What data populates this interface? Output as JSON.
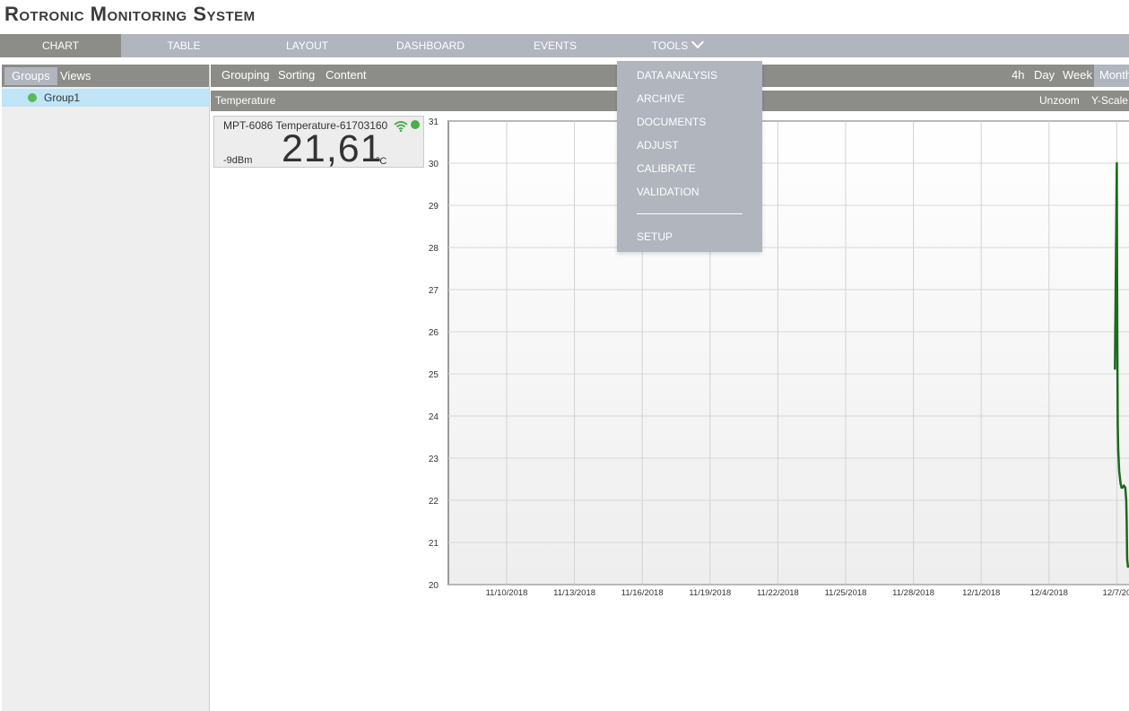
{
  "app": {
    "title": "Rotronic Monitoring System"
  },
  "nav": {
    "items": [
      {
        "label": "CHART"
      },
      {
        "label": "TABLE"
      },
      {
        "label": "LAYOUT"
      },
      {
        "label": "DASHBOARD"
      },
      {
        "label": "EVENTS"
      },
      {
        "label": "TOOLS"
      }
    ],
    "active": "CHART"
  },
  "left_panel": {
    "tabs": [
      {
        "label": "Groups"
      },
      {
        "label": "Views"
      }
    ],
    "groups": [
      {
        "name": "Group1",
        "status_color": "#5cb85c"
      }
    ]
  },
  "toolbar": {
    "grouping": "Grouping",
    "sorting": "Sorting",
    "content": "Content",
    "ranges": [
      {
        "label": "4h"
      },
      {
        "label": "Day"
      },
      {
        "label": "Week"
      },
      {
        "label": "Month"
      }
    ],
    "active_range": "Month"
  },
  "chart_header": {
    "title": "Temperature",
    "unzoom": "Unzoom",
    "yscale": "Y-Scale"
  },
  "sensor": {
    "name": "MPT-6086 Temperature-61703160",
    "signal": "-9dBm",
    "value": "21,61",
    "unit": "°C",
    "status_color": "#4cae4c"
  },
  "tools_menu": {
    "items": [
      {
        "label": "DATA ANALYSIS"
      },
      {
        "label": "ARCHIVE"
      },
      {
        "label": "DOCUMENTS"
      },
      {
        "label": "ADJUST"
      },
      {
        "label": "CALIBRATE"
      },
      {
        "label": "VALIDATION"
      },
      {
        "label": "SETUP"
      }
    ]
  },
  "chart_data": {
    "type": "line",
    "title": "Temperature",
    "xlabel": "",
    "ylabel": "",
    "ylim": [
      20,
      31
    ],
    "yticks": [
      20,
      21,
      22,
      23,
      24,
      25,
      26,
      27,
      28,
      29,
      30,
      31
    ],
    "xtick_labels": [
      "11/10/2018",
      "11/13/2018",
      "11/16/2018",
      "11/19/2018",
      "11/22/2018",
      "11/25/2018",
      "11/28/2018",
      "12/1/2018",
      "12/4/2018",
      "12/7/20"
    ],
    "grid": true,
    "series_color": "#1a6b1a",
    "series": [
      {
        "x": [
          "12/6/2018 22:00",
          "12/7/2018 00:00",
          "12/7/2018 00:30",
          "12/7/2018 01:00",
          "12/7/2018 01:30",
          "12/7/2018 02:30",
          "12/7/2018 04:00",
          "12/7/2018 05:00",
          "12/7/2018 06:00",
          "12/7/2018 07:30",
          "12/7/2018 09:00",
          "12/7/2018 10:00",
          "12/7/2018 10:30",
          "12/7/2018 11:00",
          "12/7/2018 12:00"
        ],
        "y": [
          25.1,
          30.0,
          26.0,
          23.8,
          23.2,
          22.7,
          22.4,
          22.3,
          22.3,
          22.35,
          22.3,
          22.0,
          21.5,
          20.6,
          20.4
        ]
      }
    ]
  }
}
